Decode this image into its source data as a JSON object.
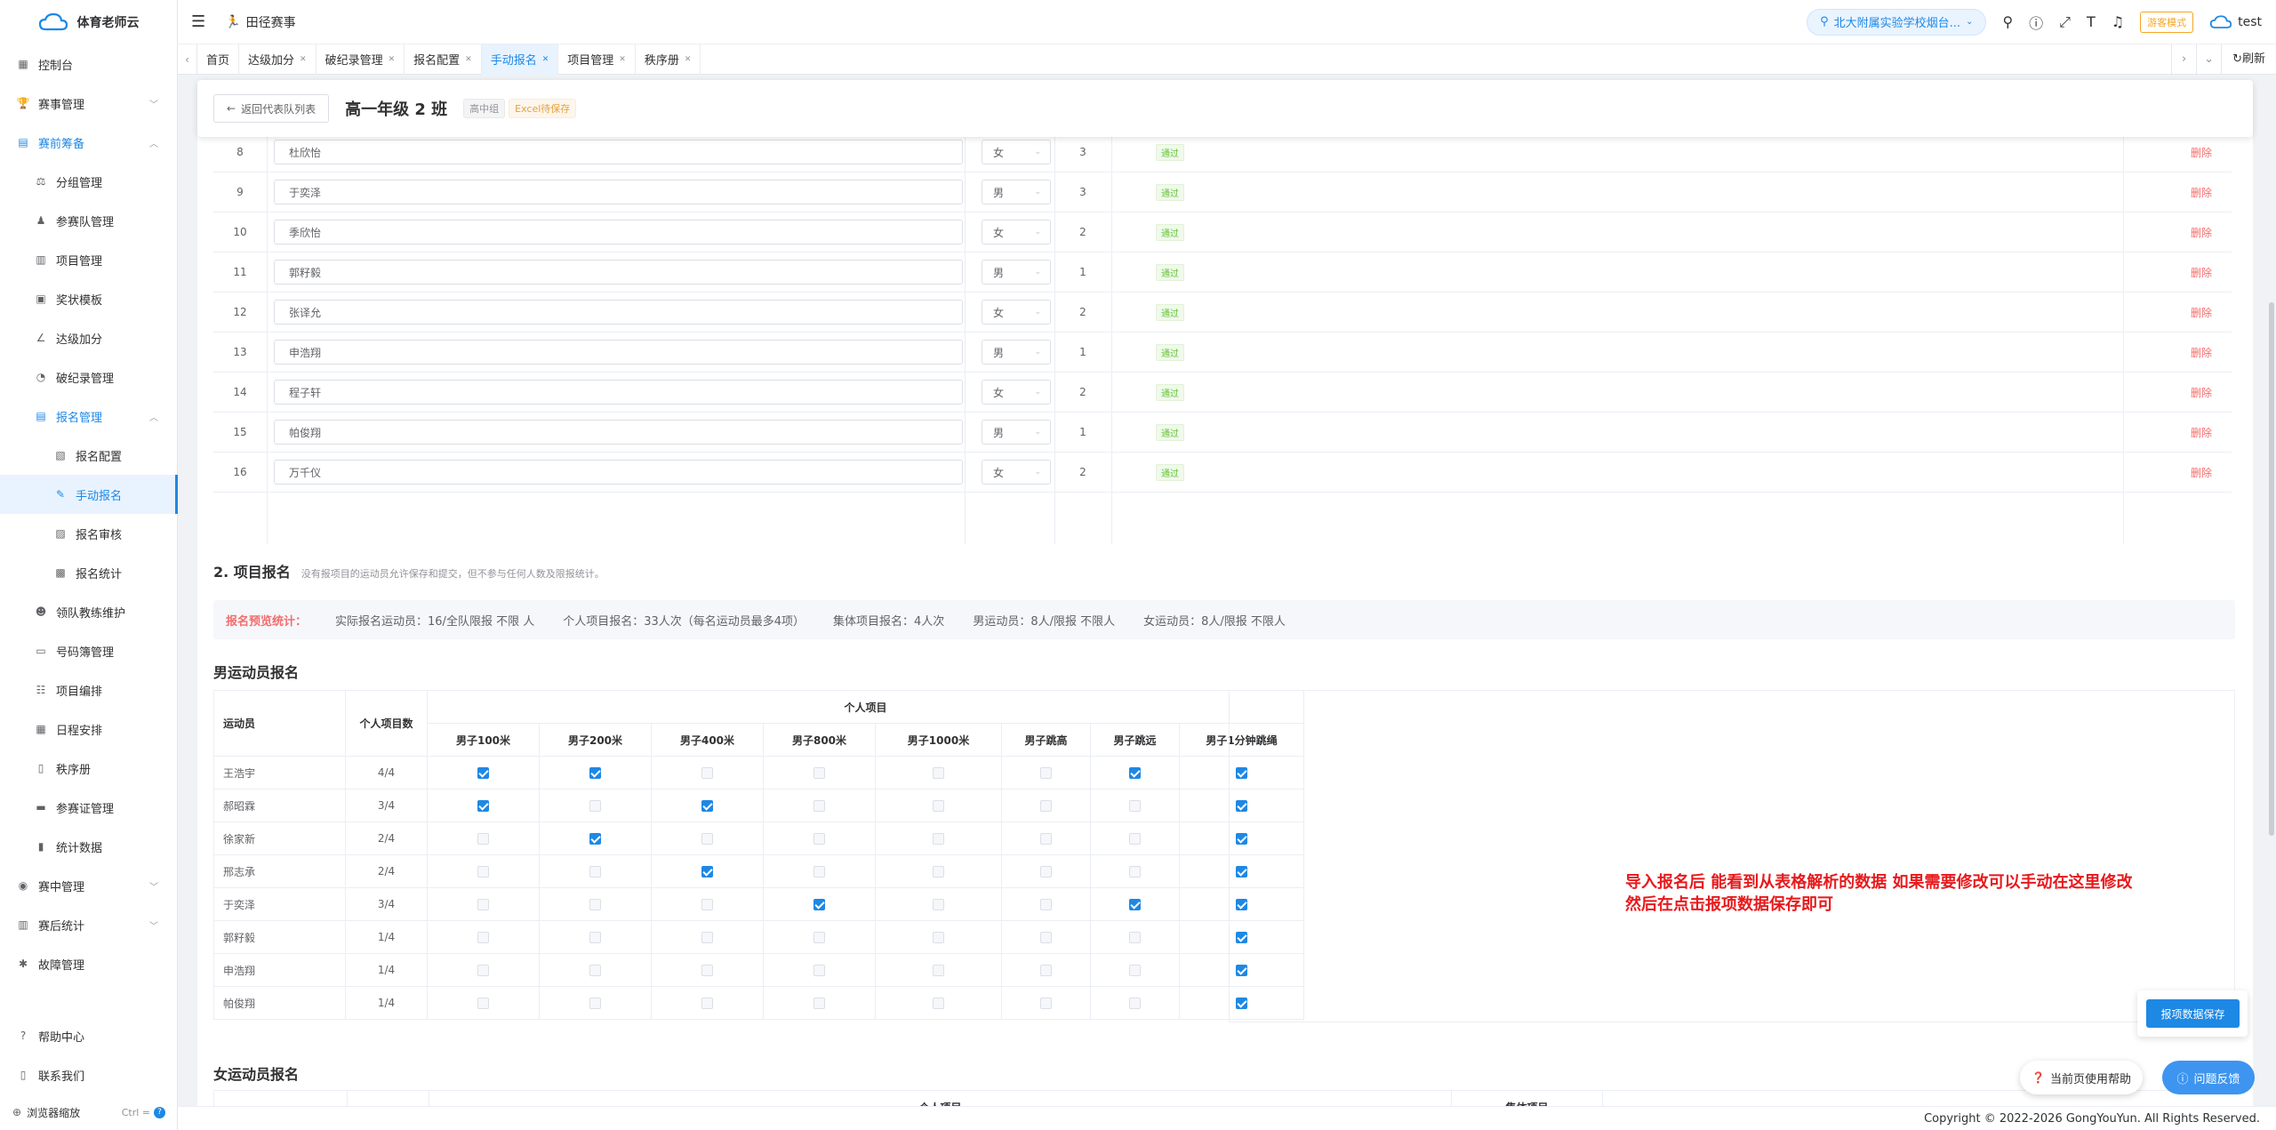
{
  "app": {
    "name": "体育老师云",
    "brand_color": "#1e88e5"
  },
  "sidebar": {
    "items": [
      {
        "label": "控制台",
        "icon": "dashboard-icon",
        "level": 0
      },
      {
        "label": "赛事管理",
        "icon": "trophy-icon",
        "level": 0,
        "arrow": "down"
      },
      {
        "label": "赛前筹备",
        "icon": "clipboard-icon",
        "level": 0,
        "arrow": "up",
        "open": true
      },
      {
        "label": "分组管理",
        "icon": "group-icon",
        "level": 1
      },
      {
        "label": "参赛队管理",
        "icon": "team-icon",
        "level": 1
      },
      {
        "label": "项目管理",
        "icon": "document-icon",
        "level": 1
      },
      {
        "label": "奖状模板",
        "icon": "certificate-icon",
        "level": 1
      },
      {
        "label": "达级加分",
        "icon": "chart-line-icon",
        "level": 1
      },
      {
        "label": "破纪录管理",
        "icon": "record-icon",
        "level": 1
      },
      {
        "label": "报名管理",
        "icon": "form-icon",
        "level": 1,
        "arrow": "up",
        "open": true
      },
      {
        "label": "报名配置",
        "icon": "config-icon",
        "level": 2
      },
      {
        "label": "手动报名",
        "icon": "user-edit-icon",
        "level": 2,
        "active": true
      },
      {
        "label": "报名审核",
        "icon": "audit-icon",
        "level": 2
      },
      {
        "label": "报名统计",
        "icon": "stats-icon",
        "level": 2
      },
      {
        "label": "领队教练维护",
        "icon": "coach-icon",
        "level": 1
      },
      {
        "label": "号码簿管理",
        "icon": "bib-icon",
        "level": 1
      },
      {
        "label": "项目编排",
        "icon": "arrange-icon",
        "level": 1
      },
      {
        "label": "日程安排",
        "icon": "calendar-icon",
        "level": 1
      },
      {
        "label": "秩序册",
        "icon": "book-icon",
        "level": 1
      },
      {
        "label": "参赛证管理",
        "icon": "card-icon",
        "level": 1
      },
      {
        "label": "统计数据",
        "icon": "bar-chart-icon",
        "level": 1
      },
      {
        "label": "赛中管理",
        "icon": "play-icon",
        "level": 0,
        "arrow": "down"
      },
      {
        "label": "赛后统计",
        "icon": "chart-icon",
        "level": 0,
        "arrow": "down"
      },
      {
        "label": "故障管理",
        "icon": "bug-icon",
        "level": 0
      }
    ],
    "bottom": {
      "help": "帮助中心",
      "contact": "联系我们",
      "zoom": "浏览器缩放",
      "zoom_key": "Ctrl ="
    }
  },
  "header": {
    "breadcrumb": "田径赛事",
    "school": "北大附属实验学校烟台...",
    "guest_mode": "游客模式",
    "user": "test"
  },
  "tabs": [
    {
      "label": "首页",
      "closable": false
    },
    {
      "label": "达级加分",
      "closable": true
    },
    {
      "label": "破纪录管理",
      "closable": true
    },
    {
      "label": "报名配置",
      "closable": true
    },
    {
      "label": "手动报名",
      "closable": true,
      "active": true
    },
    {
      "label": "项目管理",
      "closable": true
    },
    {
      "label": "秩序册",
      "closable": true
    }
  ],
  "tabs_refresh": "刷新",
  "page": {
    "back": "返回代表队列表",
    "title": "高一年级 2 班",
    "tag_group": "高中组",
    "tag_status": "Excel待保存"
  },
  "roster": {
    "rows": [
      {
        "no": "8",
        "name": "杜欣怡",
        "gender": "女",
        "count": "3",
        "status": "通过",
        "action": "删除"
      },
      {
        "no": "9",
        "name": "于奕泽",
        "gender": "男",
        "count": "3",
        "status": "通过",
        "action": "删除"
      },
      {
        "no": "10",
        "name": "季欣怡",
        "gender": "女",
        "count": "2",
        "status": "通过",
        "action": "删除"
      },
      {
        "no": "11",
        "name": "郭籽毅",
        "gender": "男",
        "count": "1",
        "status": "通过",
        "action": "删除"
      },
      {
        "no": "12",
        "name": "张译允",
        "gender": "女",
        "count": "2",
        "status": "通过",
        "action": "删除"
      },
      {
        "no": "13",
        "name": "申浩翔",
        "gender": "男",
        "count": "1",
        "status": "通过",
        "action": "删除"
      },
      {
        "no": "14",
        "name": "程子轩",
        "gender": "女",
        "count": "2",
        "status": "通过",
        "action": "删除"
      },
      {
        "no": "15",
        "name": "帕俊翔",
        "gender": "男",
        "count": "1",
        "status": "通过",
        "action": "删除"
      },
      {
        "no": "16",
        "name": "万千仪",
        "gender": "女",
        "count": "2",
        "status": "通过",
        "action": "删除"
      }
    ]
  },
  "events": {
    "title": "2. 项目报名",
    "desc": "没有报项目的运动员允许保存和提交，但不参与任何人数及限报统计。",
    "stats_label": "报名预览统计：",
    "stats": [
      "实际报名运动员：16/全队限报 不限 人",
      "个人项目报名：33人次（每名运动员最多4项）",
      "集体项目报名：4人次",
      "男运动员：8人/限报 不限人",
      "女运动员：8人/限报 不限人"
    ],
    "male_title": "男运动员报名",
    "female_title": "女运动员报名",
    "col_athlete": "运动员",
    "col_count": "个人项目数",
    "col_individual": "个人项目",
    "col_team": "集体项目",
    "male_events": [
      "男子100米",
      "男子200米",
      "男子400米",
      "男子800米",
      "男子1000米",
      "男子跳高",
      "男子跳远",
      "男子1分钟跳绳"
    ],
    "male_rows": [
      {
        "name": "王浩宇",
        "count": "4/4",
        "checks": [
          true,
          true,
          false,
          false,
          false,
          false,
          true,
          true
        ]
      },
      {
        "name": "郝昭霖",
        "count": "3/4",
        "checks": [
          true,
          false,
          true,
          false,
          false,
          false,
          false,
          true
        ]
      },
      {
        "name": "徐家新",
        "count": "2/4",
        "checks": [
          false,
          true,
          false,
          false,
          false,
          false,
          false,
          true
        ]
      },
      {
        "name": "邢志承",
        "count": "2/4",
        "checks": [
          false,
          false,
          true,
          false,
          false,
          false,
          false,
          true
        ]
      },
      {
        "name": "于奕泽",
        "count": "3/4",
        "checks": [
          false,
          false,
          false,
          true,
          false,
          false,
          true,
          true
        ]
      },
      {
        "name": "郭籽毅",
        "count": "1/4",
        "checks": [
          false,
          false,
          false,
          false,
          false,
          false,
          false,
          true
        ]
      },
      {
        "name": "申浩翔",
        "count": "1/4",
        "checks": [
          false,
          false,
          false,
          false,
          false,
          false,
          false,
          true
        ]
      },
      {
        "name": "帕俊翔",
        "count": "1/4",
        "checks": [
          false,
          false,
          false,
          false,
          false,
          false,
          false,
          true
        ]
      }
    ],
    "save_button": "报项数据保存"
  },
  "annotation": {
    "line1": "导入报名后 能看到从表格解析的数据  如果需要修改可以手动在这里修改",
    "line2": "然后在点击报项数据保存即可",
    "color": "#e8191c"
  },
  "float": {
    "help": "当前页使用帮助",
    "feedback": "问题反馈"
  },
  "footer": {
    "copyright": "Copyright © 2022-2026 GongYouYun. All Rights Reserved."
  }
}
